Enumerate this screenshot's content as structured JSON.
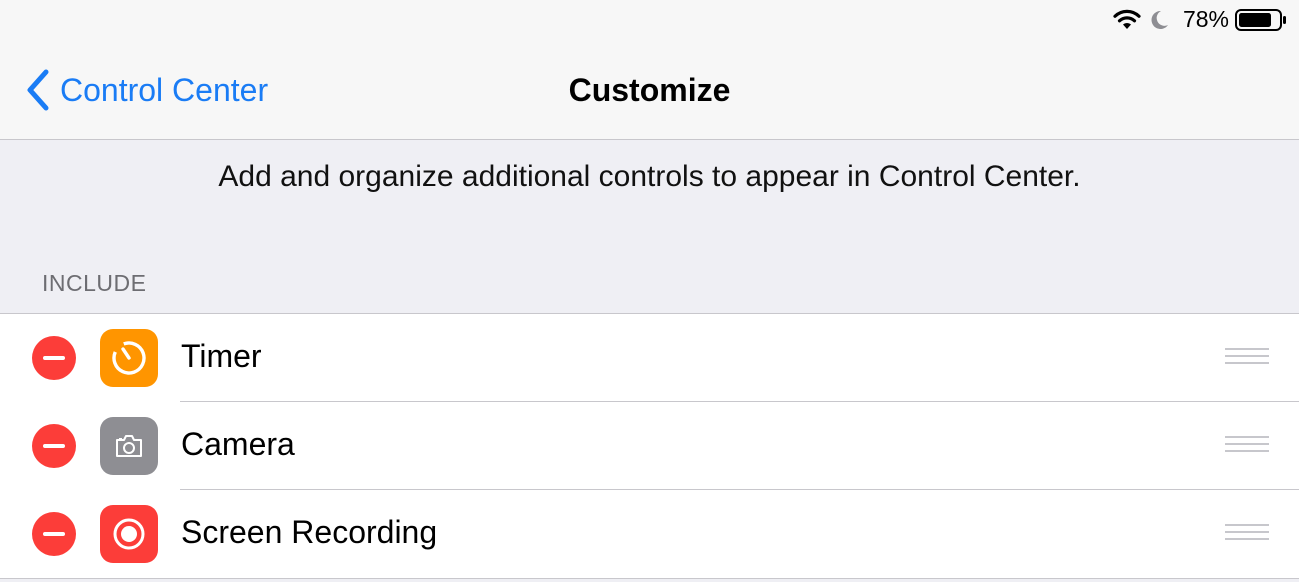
{
  "status_bar": {
    "battery_percent": "78%",
    "icons": [
      "wifi-icon",
      "moon-icon",
      "battery-icon"
    ]
  },
  "nav": {
    "back_label": "Control Center",
    "title": "Customize"
  },
  "description": "Add and organize additional controls to appear in Control Center.",
  "section": {
    "header": "INCLUDE",
    "items": [
      {
        "label": "Timer",
        "icon": "timer-icon",
        "icon_bg": "#ff9500"
      },
      {
        "label": "Camera",
        "icon": "camera-icon",
        "icon_bg": "#8e8e93"
      },
      {
        "label": "Screen Recording",
        "icon": "screen-recording-icon",
        "icon_bg": "#fc3d39"
      }
    ]
  },
  "colors": {
    "accent": "#1a7cf5",
    "remove": "#fc3d39"
  }
}
